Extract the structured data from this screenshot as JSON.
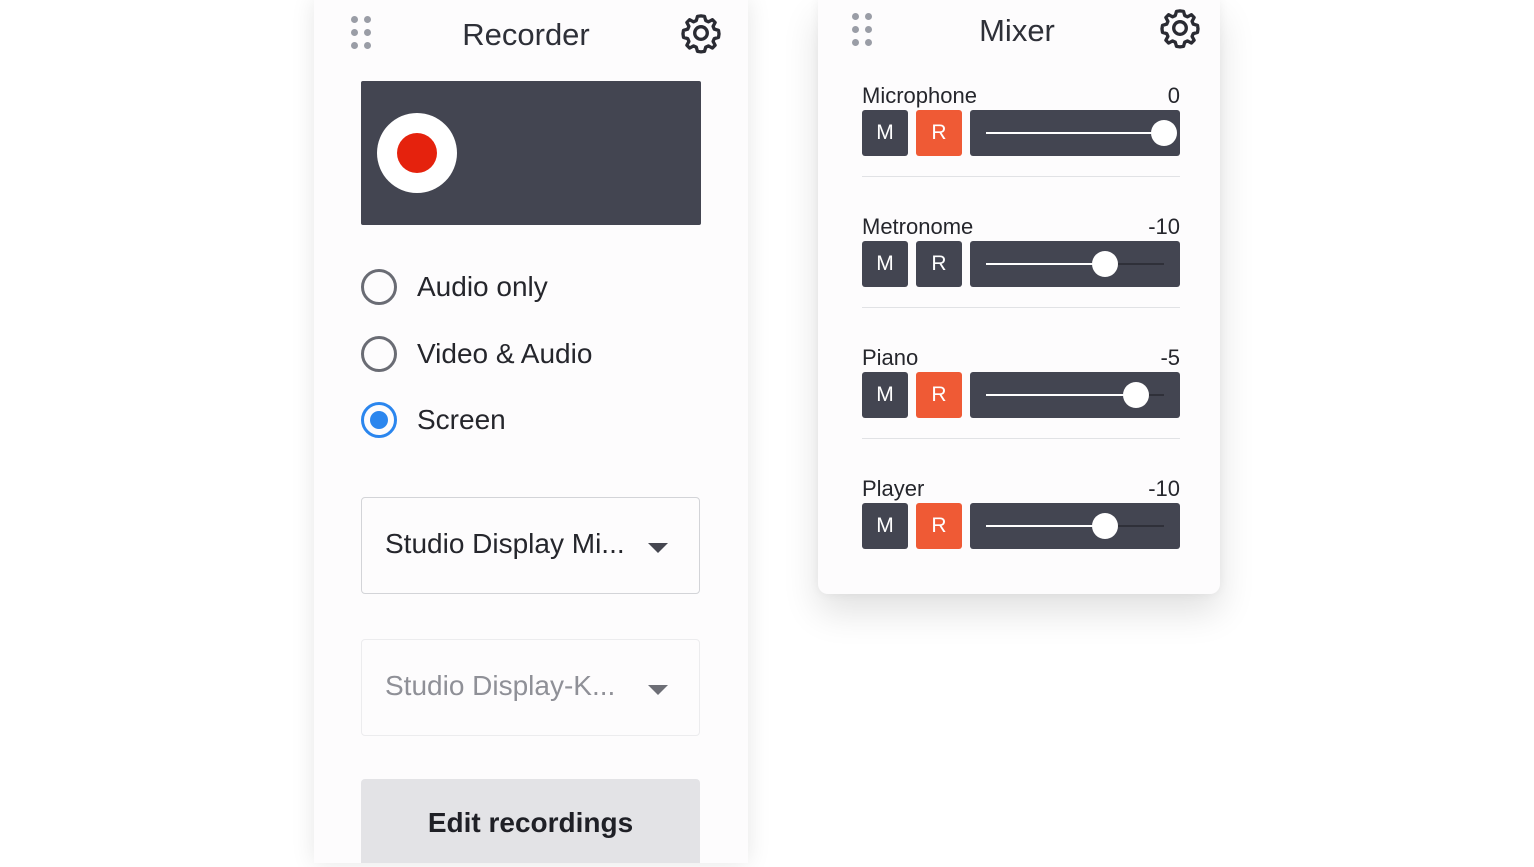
{
  "recorder": {
    "title": "Recorder",
    "settings_icon": "gear-icon",
    "drag_icon": "drag-handle-icon",
    "record_button_icon": "record-dot-icon",
    "modes": [
      {
        "label": "Audio only",
        "checked": false
      },
      {
        "label": "Video & Audio",
        "checked": false
      },
      {
        "label": "Screen",
        "checked": true
      }
    ],
    "microphone_select": {
      "value": "Studio Display Mi...",
      "enabled": true
    },
    "camera_select": {
      "value": "Studio Display-K...",
      "enabled": false
    },
    "edit_button_label": "Edit recordings"
  },
  "mixer": {
    "title": "Mixer",
    "settings_icon": "gear-icon",
    "drag_icon": "drag-handle-icon",
    "channels": [
      {
        "name": "Microphone",
        "value": "0",
        "mute_label": "M",
        "record_label": "R",
        "record_active": true,
        "level": 1.0
      },
      {
        "name": "Metronome",
        "value": "-10",
        "mute_label": "M",
        "record_label": "R",
        "record_active": false,
        "level": 0.67
      },
      {
        "name": "Piano",
        "value": "-5",
        "mute_label": "M",
        "record_label": "R",
        "record_active": true,
        "level": 0.84
      },
      {
        "name": "Player",
        "value": "-10",
        "mute_label": "M",
        "record_label": "R",
        "record_active": true,
        "level": 0.67
      }
    ]
  },
  "colors": {
    "panel_bg": "#fdfcfd",
    "dark_control": "#434551",
    "record_red": "#e5220d",
    "record_active": "#ef5a35",
    "radio_selected": "#2b86ee"
  }
}
